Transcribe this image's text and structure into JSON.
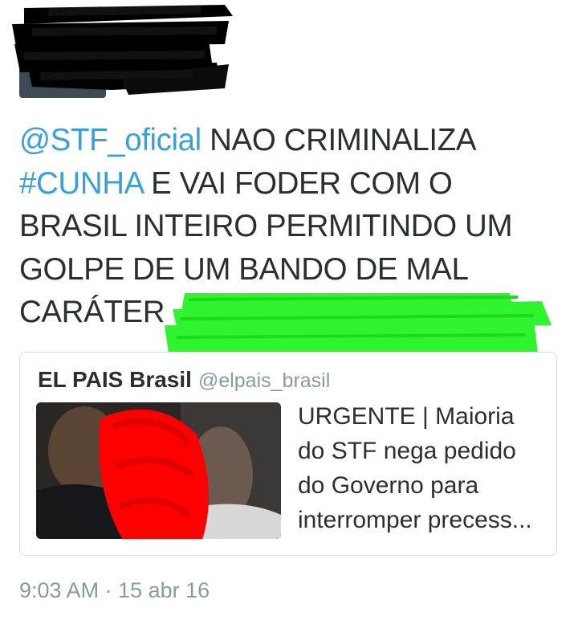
{
  "tweet": {
    "mention": "@STF_oficial",
    "text_part1": " NAO CRIMINALIZA ",
    "hashtag": "#CUNHA",
    "text_part2": " E VAI FODER COM O BRASIL INTEIRO PERMITINDO UM GOLPE DE UM BANDO DE MAL CARÁTER"
  },
  "quoted_tweet": {
    "author_name": "EL PAIS Brasil",
    "author_handle": "@elpais_brasil",
    "summary": "URGENTE | Maioria do STF nega pedido do Governo para interromper precess..."
  },
  "timestamp": "9:03 AM · 15 abr 16",
  "colors": {
    "link": "#3aa0d8",
    "text": "#292f33",
    "muted": "#8899a6",
    "green_redaction": "#2ef52e",
    "red_redaction": "#ff0000"
  }
}
